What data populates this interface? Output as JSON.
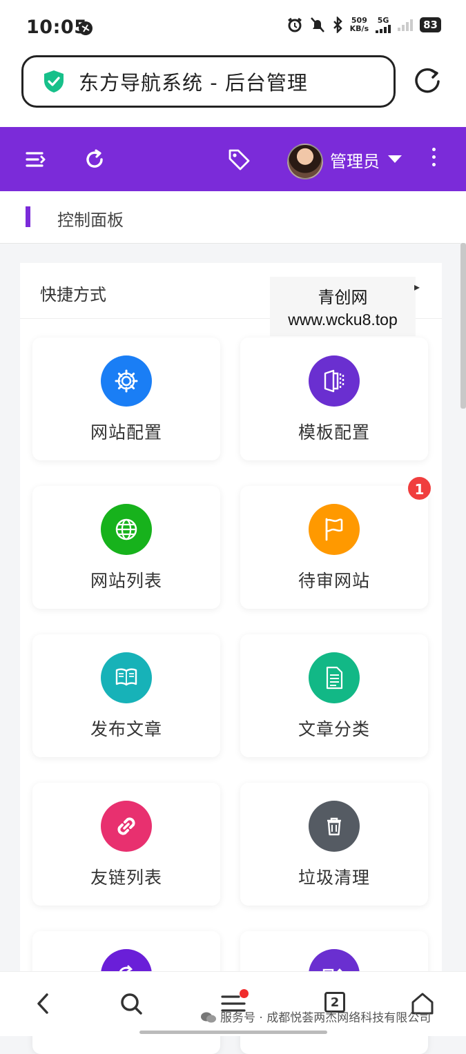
{
  "status_bar": {
    "time": "10:05",
    "net_speed_value": "509",
    "net_speed_unit": "KB/s",
    "network_type": "5G",
    "battery": "83"
  },
  "browser": {
    "page_title": "东方导航系统 - 后台管理"
  },
  "header": {
    "admin_name": "管理员",
    "accent_color": "#7b2bd9"
  },
  "breadcrumb": {
    "label": "控制面板"
  },
  "card": {
    "title": "快捷方式"
  },
  "watermark": {
    "line1": "青创网",
    "line2": "www.wcku8.top"
  },
  "shortcuts": [
    {
      "label": "网站配置",
      "icon": "gear-icon",
      "color": "#1a7ef5"
    },
    {
      "label": "模板配置",
      "icon": "template-icon",
      "color": "#6a2fd0"
    },
    {
      "label": "网站列表",
      "icon": "globe-icon",
      "color": "#17b21c"
    },
    {
      "label": "待审网站",
      "icon": "flag-icon",
      "color": "#ff9900",
      "badge": "1"
    },
    {
      "label": "发布文章",
      "icon": "book-icon",
      "color": "#17b2b8"
    },
    {
      "label": "文章分类",
      "icon": "document-icon",
      "color": "#12b886"
    },
    {
      "label": "友链列表",
      "icon": "link-icon",
      "color": "#e8306f"
    },
    {
      "label": "垃圾清理",
      "icon": "trash-icon",
      "color": "#555b63"
    },
    {
      "label": "",
      "icon": "refresh-icon",
      "color": "#6a1fd8"
    },
    {
      "label": "",
      "icon": "shapes-icon",
      "color": "#6a2fd0"
    }
  ],
  "bottom_nav": {
    "tab_count": "2",
    "credit": "服务号 · 成都悦荟两杰网络科技有限公司"
  }
}
